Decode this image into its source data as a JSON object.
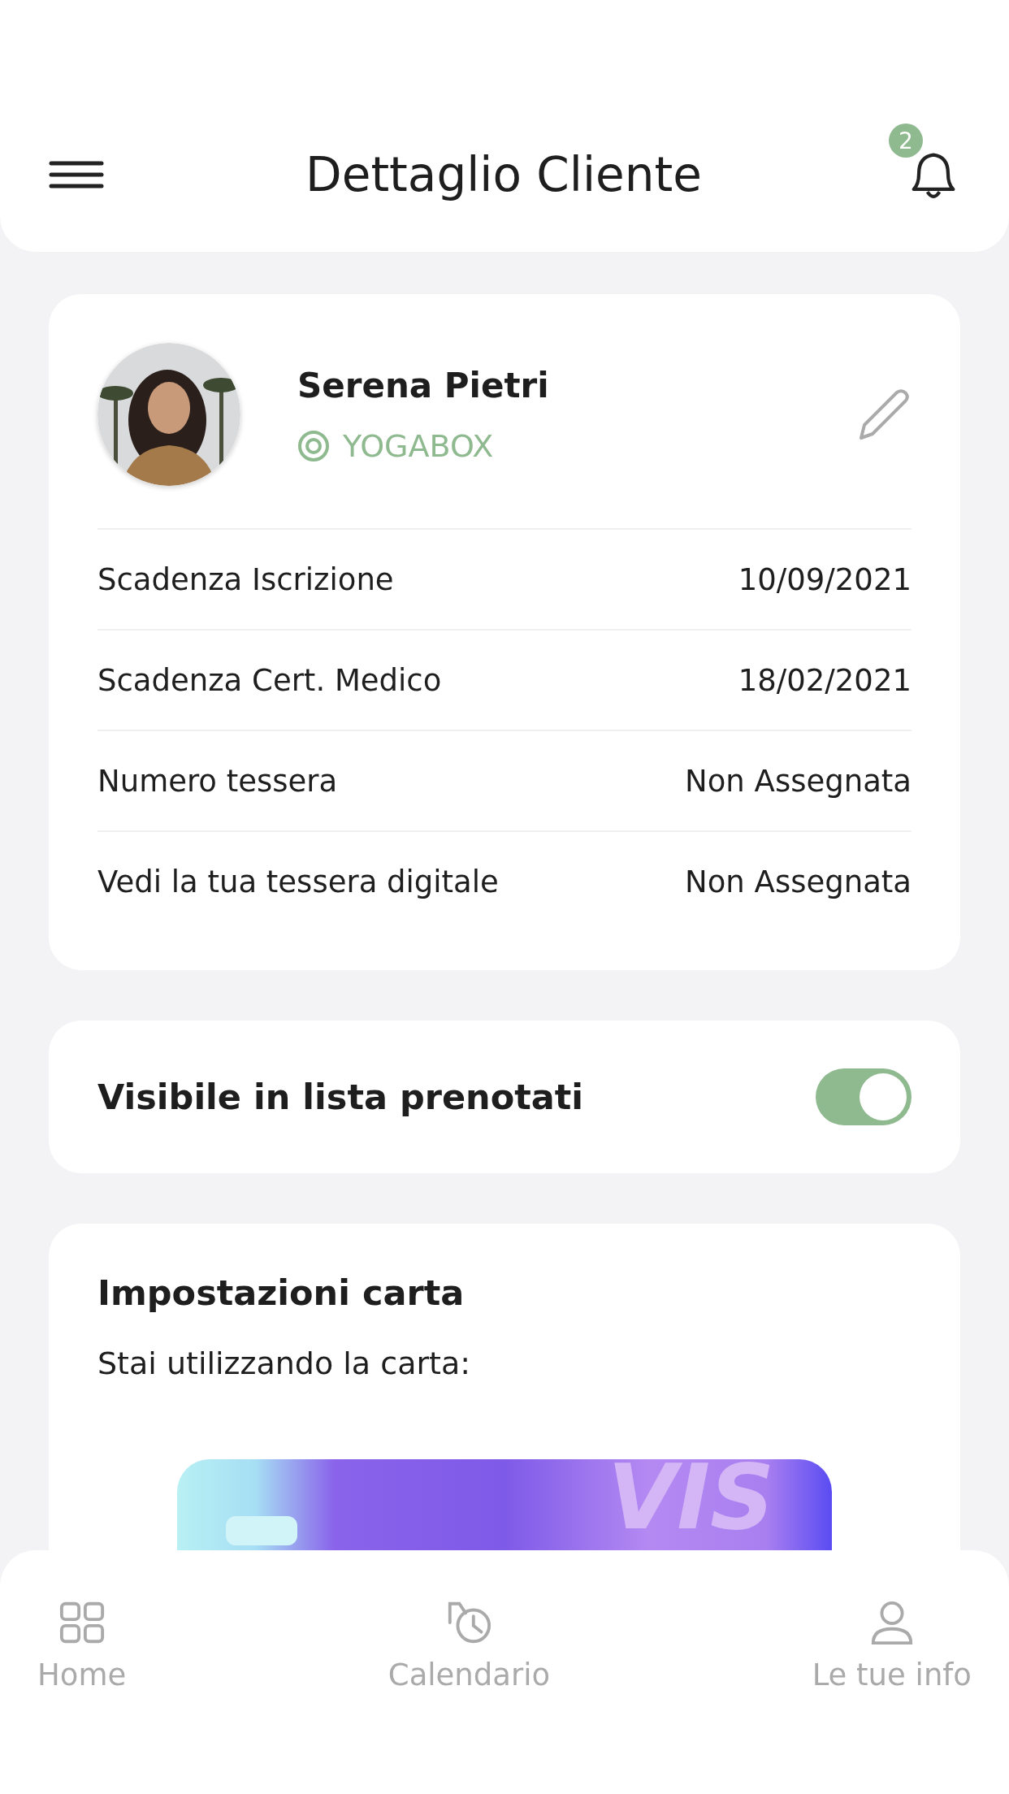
{
  "header": {
    "title": "Dettaglio Cliente",
    "notification_count": "2"
  },
  "profile": {
    "name": "Serena Pietri",
    "gym": "YOGABOX",
    "rows": [
      {
        "label": "Scadenza Iscrizione",
        "value": "10/09/2021"
      },
      {
        "label": "Scadenza Cert. Medico",
        "value": "18/02/2021"
      },
      {
        "label": "Numero tessera",
        "value": "Non Assegnata"
      },
      {
        "label": "Vedi la tua tessera digitale",
        "value": "Non Assegnata"
      }
    ]
  },
  "visibility": {
    "label": "Visibile in lista prenotati",
    "on": true
  },
  "card_settings": {
    "title": "Impostazioni carta",
    "subtitle": "Stai utilizzando la carta:",
    "card_brand": "VIS"
  },
  "bottom_nav": [
    {
      "label": "Home",
      "kind": "grid"
    },
    {
      "label": "Calendario",
      "kind": "history"
    },
    {
      "label": "Le tue info",
      "kind": "user"
    }
  ]
}
